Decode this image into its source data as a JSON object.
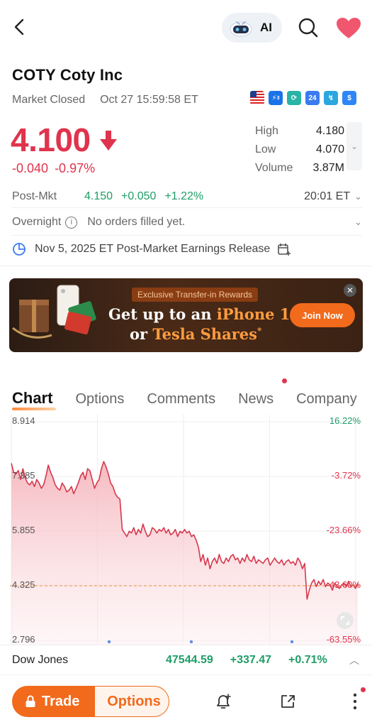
{
  "header": {
    "ai_label": "AI",
    "colors": {
      "heart": "#f0576e",
      "accent": "#f26a1b",
      "down": "#e0334d",
      "up": "#1e9d68"
    }
  },
  "stock": {
    "ticker_line": "COTY  Coty Inc",
    "status": "Market Closed",
    "timestamp": "Oct 27 15:59:58 ET",
    "price": "4.100",
    "change": "-0.040",
    "change_pct": "-0.97%",
    "stats": [
      {
        "label": "High",
        "value": "4.180"
      },
      {
        "label": "Low",
        "value": "4.070"
      },
      {
        "label": "Volume",
        "value": "3.87M"
      }
    ],
    "badges": [
      "us-flag-icon",
      "lightning-3-icon",
      "cycle-icon",
      "24-hour-icon",
      "chart-badge-icon",
      "dollar-icon"
    ],
    "badge_24_text": "24",
    "badge_3_text": "3",
    "badge_dollar_text": "$"
  },
  "post_market": {
    "label": "Post-Mkt",
    "price": "4.150",
    "change": "+0.050",
    "change_pct": "+1.22%",
    "time": "20:01 ET"
  },
  "overnight": {
    "label": "Overnight",
    "info_glyph": "i",
    "message": "No orders filled yet."
  },
  "earnings": {
    "text": "Nov 5, 2025 ET Post-Market Earnings Release"
  },
  "banner": {
    "tag": "Exclusive Transfer-in Rewards",
    "line1_a": "Get up to an ",
    "line1_b": "iPhone 16",
    "line1_sup": "*",
    "line2_a": "or ",
    "line2_b": "Tesla Shares",
    "line2_sup": "*",
    "cta": "Join Now",
    "close_glyph": "✕"
  },
  "tabs": [
    "Chart",
    "Options",
    "Comments",
    "News",
    "Company"
  ],
  "chart_data": {
    "type": "area",
    "y_ticks_left": [
      "8.914",
      "7.385",
      "5.855",
      "4.325",
      "2.796"
    ],
    "y_ticks_right": [
      "16.22%",
      "-3.72%",
      "-23.66%",
      "-43.60%",
      "-63.55%"
    ],
    "ylim": [
      2.796,
      8.914
    ],
    "reference_price": 4.325,
    "grid": true,
    "values": [
      7.75,
      7.5,
      7.45,
      7.55,
      7.3,
      7.6,
      7.35,
      7.2,
      7.15,
      7.25,
      7.1,
      7.3,
      7.2,
      7.05,
      7.15,
      7.4,
      7.7,
      7.5,
      7.35,
      7.15,
      7.05,
      7.0,
      7.2,
      7.1,
      6.95,
      7.0,
      7.1,
      6.9,
      7.05,
      7.2,
      7.4,
      7.5,
      7.3,
      7.6,
      7.55,
      7.3,
      7.05,
      7.2,
      7.3,
      7.6,
      7.8,
      7.65,
      7.45,
      7.2,
      7.1,
      6.9,
      6.8,
      6.75,
      5.9,
      5.8,
      5.7,
      5.85,
      5.8,
      5.95,
      5.75,
      5.9,
      5.8,
      6.05,
      5.85,
      5.7,
      5.75,
      5.95,
      5.9,
      5.8,
      5.9,
      5.85,
      5.95,
      5.8,
      5.9,
      5.75,
      5.8,
      5.9,
      5.7,
      5.85,
      5.8,
      5.9,
      5.8,
      5.85,
      5.7,
      5.75,
      5.6,
      5.4,
      5.0,
      5.2,
      4.9,
      5.1,
      4.8,
      5.0,
      5.1,
      4.95,
      5.2,
      5.0,
      4.95,
      5.1,
      5.0,
      5.15,
      5.2,
      5.05,
      5.1,
      4.95,
      5.1,
      5.0,
      5.2,
      5.05,
      5.0,
      5.15,
      4.95,
      5.05,
      5.0,
      4.95,
      5.05,
      5.1,
      4.9,
      5.0,
      5.1,
      5.0,
      4.95,
      5.05,
      4.9,
      5.0,
      5.05,
      4.95,
      5.0,
      4.9,
      5.1,
      5.0,
      4.8,
      4.95,
      3.95,
      4.2,
      4.4,
      4.5,
      4.3,
      4.45,
      4.35,
      4.5,
      4.3,
      4.4,
      4.35,
      4.2,
      4.4,
      4.3,
      4.25,
      4.35,
      4.4,
      4.3,
      4.45,
      4.3,
      4.35,
      4.25,
      4.4
    ]
  },
  "ticker_strip": {
    "name": "Dow Jones",
    "value": "47544.59",
    "change": "+337.47",
    "change_pct": "+0.71%"
  },
  "bottom_bar": {
    "trade_label": "Trade",
    "options_label": "Options"
  }
}
